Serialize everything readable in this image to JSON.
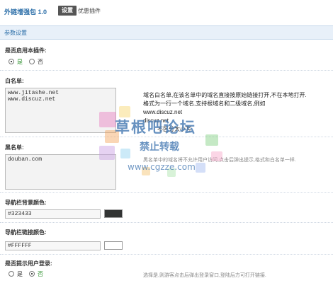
{
  "header": {
    "plugin_title": "外链增强包 1.0",
    "tabs": [
      {
        "label": "设置",
        "active": true
      },
      {
        "label": "优惠插件",
        "active": false
      }
    ]
  },
  "section": {
    "title": "参数设置"
  },
  "enable": {
    "label": "是否启用本插件:",
    "options": [
      "是",
      "否"
    ],
    "selected": "是"
  },
  "whitelist": {
    "label": "白名单:",
    "value": "www.jitashe.net\nwww.discuz.net",
    "description_line1": "域名白名单,在该名单中的域名直接按原始链接打开,不在本地打开.",
    "description_line2": "格式为一行一个域名,支持根域名和二级域名,例如",
    "example1": "www.discuz.net",
    "example2": "discuz.net",
    "example_note": "不区分大小写"
  },
  "blacklist": {
    "label": "黑名单:",
    "value": "douban.com",
    "description": "黑名单中的域名将不允许用户访问,点击后弹出提示,格式和白名单一样."
  },
  "nav_bg": {
    "label": "导航栏背景颜色:",
    "value": "#323433",
    "swatch_color": "#323433"
  },
  "nav_link": {
    "label": "导航栏链接颜色:",
    "value": "#FFFFFF",
    "swatch_color": "#FFFFFF"
  },
  "login_prompt": {
    "label": "是否提示用户登录:",
    "options": [
      "是",
      "否"
    ],
    "selected": "否",
    "description": "选择是,则游客点击后弹出登录窗口,登陆后方可打开链接."
  },
  "watermark": {
    "main": "草根吧论坛",
    "sub": "禁止转载",
    "url": "www.cgzze.com"
  },
  "colors": {
    "accent": "#2b6ea8",
    "header_bg": "#e8f0f9",
    "active_green": "#2a8f2a"
  }
}
